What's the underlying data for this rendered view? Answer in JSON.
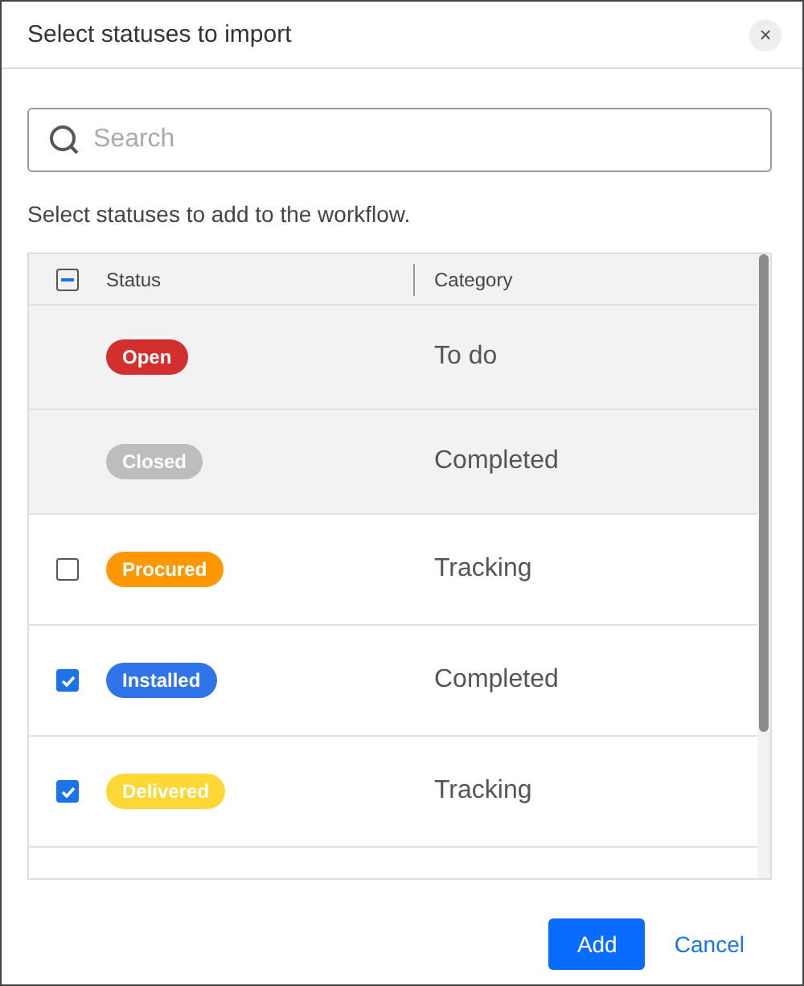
{
  "dialog": {
    "title": "Select statuses to import",
    "close": "×"
  },
  "search": {
    "placeholder": "Search"
  },
  "instruction": "Select statuses to add to the workflow.",
  "table": {
    "select_all": {
      "indeterminate": true
    },
    "columns": [
      "Status",
      "Category"
    ],
    "rows": [
      {
        "status": "Open",
        "color": "#d32f2f",
        "category": "To do",
        "disabled": true
      },
      {
        "status": "Closed",
        "color": "#bdbdbd",
        "category": "Completed",
        "disabled": true
      },
      {
        "status": "Procured",
        "color": "#ff9800",
        "category": "Tracking",
        "disabled": false,
        "checked": false
      },
      {
        "status": "Installed",
        "color": "#2f74e8",
        "category": "Completed",
        "disabled": false,
        "checked": true
      },
      {
        "status": "Delivered",
        "color": "#fdd835",
        "category": "Tracking",
        "disabled": false,
        "checked": true
      }
    ]
  },
  "buttons": {
    "primary": "Add",
    "secondary": "Cancel"
  }
}
